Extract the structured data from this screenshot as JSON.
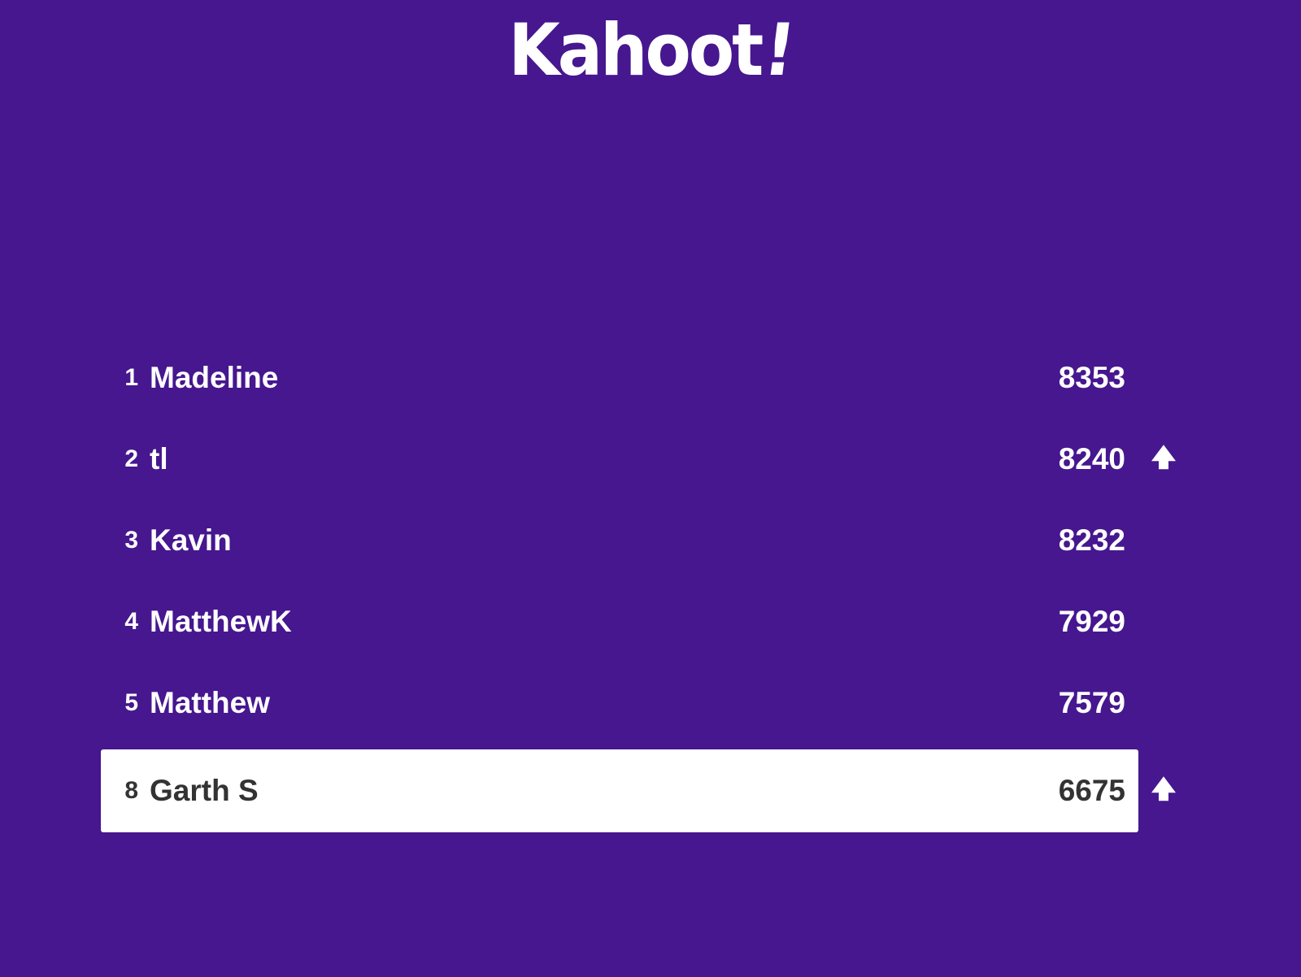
{
  "brand": {
    "logo_text": "Kahoot",
    "logo_bang": "!"
  },
  "colors": {
    "background": "#46178f",
    "row_text": "#ffffff",
    "highlight_bg": "#ffffff",
    "highlight_text": "#333333"
  },
  "leaderboard": [
    {
      "rank": "1",
      "name": "Madeline",
      "score": "8353",
      "trend": ""
    },
    {
      "rank": "2",
      "name": "tl",
      "score": "8240",
      "trend": "up-arrow-icon"
    },
    {
      "rank": "3",
      "name": "Kavin",
      "score": "8232",
      "trend": ""
    },
    {
      "rank": "4",
      "name": "MatthewK",
      "score": "7929",
      "trend": ""
    },
    {
      "rank": "5",
      "name": "Matthew",
      "score": "7579",
      "trend": ""
    },
    {
      "rank": "8",
      "name": "Garth S",
      "score": "6675",
      "trend": "up-arrow-icon",
      "highlighted": true
    }
  ]
}
